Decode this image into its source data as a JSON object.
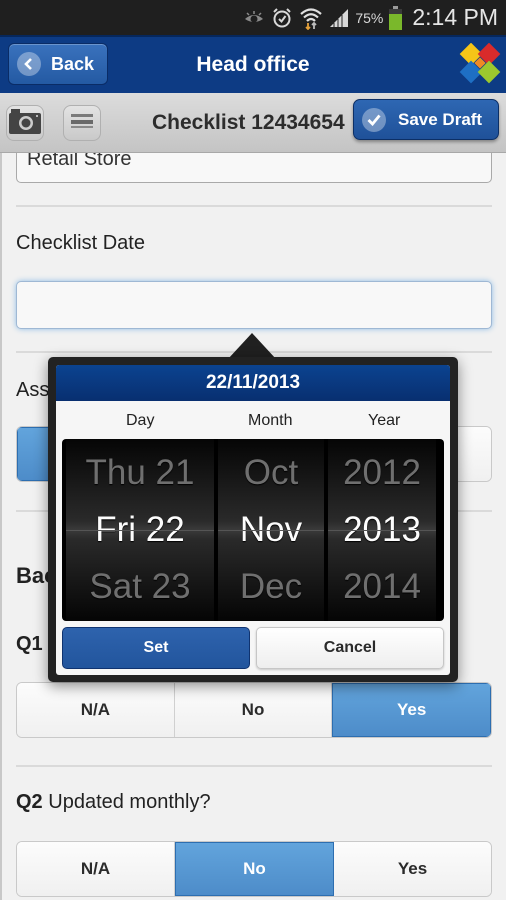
{
  "status_bar": {
    "icons": [
      "eye-icon",
      "alarm-icon",
      "wifi-icon",
      "signal-icon",
      "battery-icon"
    ],
    "battery_percent": "75%",
    "battery_level": 0.75,
    "time": "2:14 PM"
  },
  "header": {
    "back_label": "Back",
    "title": "Head office",
    "logo": "app-logo"
  },
  "toolbar": {
    "camera_icon": "camera-icon",
    "notes_icon": "list-icon",
    "title": "Checklist 12434654",
    "save_label": "Save Draft"
  },
  "form": {
    "store_value": "Retail Store",
    "checklist_date_label": "Checklist Date",
    "checklist_date_value": "",
    "assessor_label_partial": "Ass",
    "section_label_partial": "Bac",
    "q1": {
      "number": "Q1",
      "options": [
        "N/A",
        "No",
        "Yes"
      ],
      "selected": "Yes"
    },
    "q2": {
      "number": "Q2",
      "text": "Updated monthly?",
      "options": [
        "N/A",
        "No",
        "Yes"
      ],
      "selected": "No"
    }
  },
  "date_picker": {
    "title": "22/11/2013",
    "columns": [
      {
        "header": "Day",
        "values": [
          "Thu 21",
          "Fri 22",
          "Sat 23"
        ],
        "selected": "Fri 22"
      },
      {
        "header": "Month",
        "values": [
          "Oct",
          "Nov",
          "Dec"
        ],
        "selected": "Nov"
      },
      {
        "header": "Year",
        "values": [
          "2012",
          "2013",
          "2014"
        ],
        "selected": "2013"
      }
    ],
    "set_label": "Set",
    "cancel_label": "Cancel"
  },
  "colors": {
    "header_bg": "#0d3b84",
    "primary_button": "#245aa3",
    "segment_active": "#5597d2",
    "status_bar_bg": "#1f1f1f",
    "battery_green": "#7ab82b"
  }
}
